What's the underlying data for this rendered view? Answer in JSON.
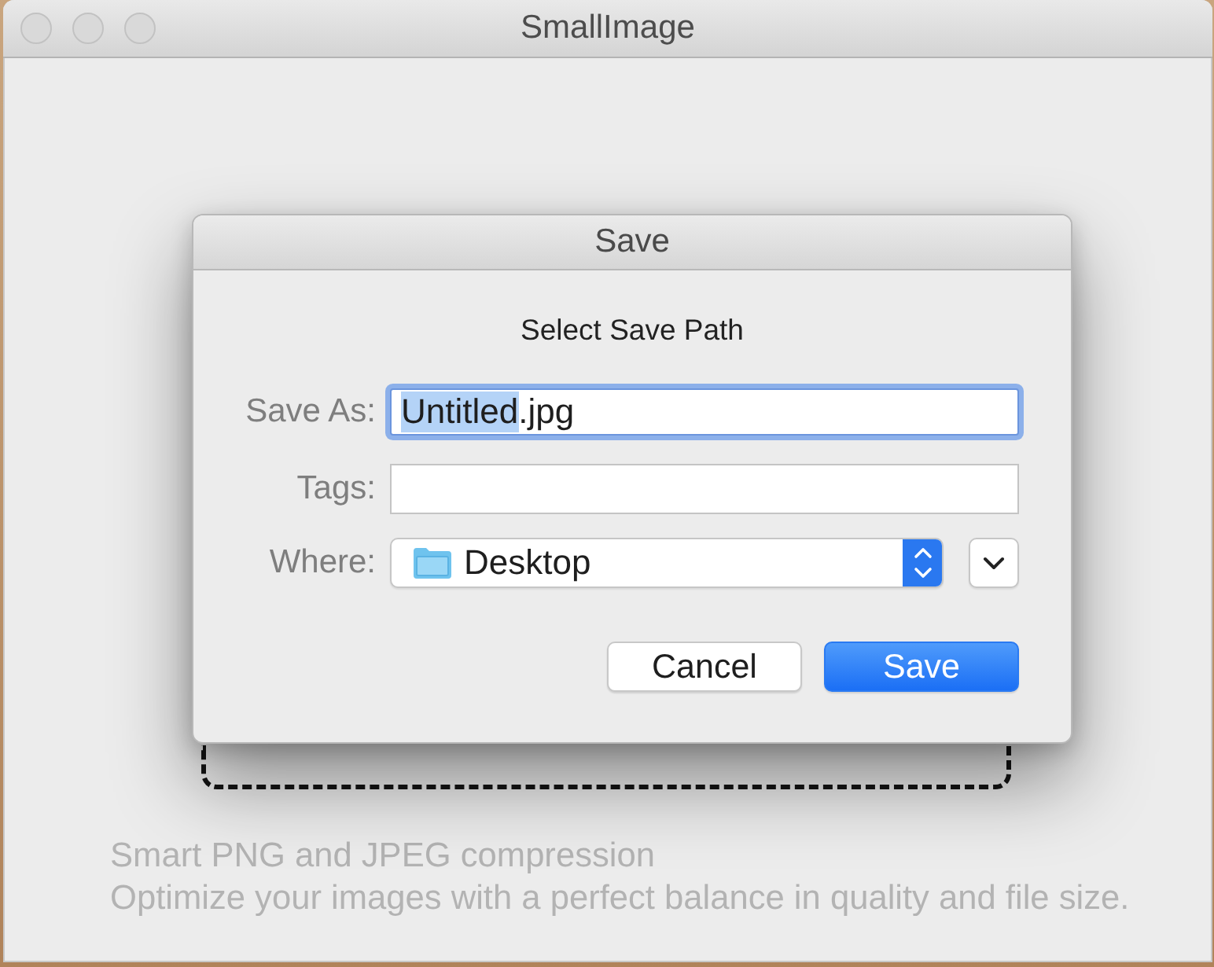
{
  "window": {
    "title": "SmallImage",
    "active": false
  },
  "dialog": {
    "title": "Save",
    "message": "Select Save Path",
    "fields": [
      {
        "kind": "text",
        "label": "Save As:",
        "focused": true,
        "selected_text": "Untitled",
        "text_after": ".jpg"
      },
      {
        "kind": "text",
        "label": "Tags:",
        "focused": false
      },
      {
        "kind": "popup",
        "label": "Where:",
        "value": "Desktop",
        "expanded": false
      }
    ],
    "buttons": [
      {
        "label": "Cancel",
        "default": false
      },
      {
        "label": "Save",
        "default": true
      }
    ]
  },
  "description": [
    "Smart PNG and JPEG compression",
    "Optimize your images with a perfect balance in quality and file size."
  ]
}
